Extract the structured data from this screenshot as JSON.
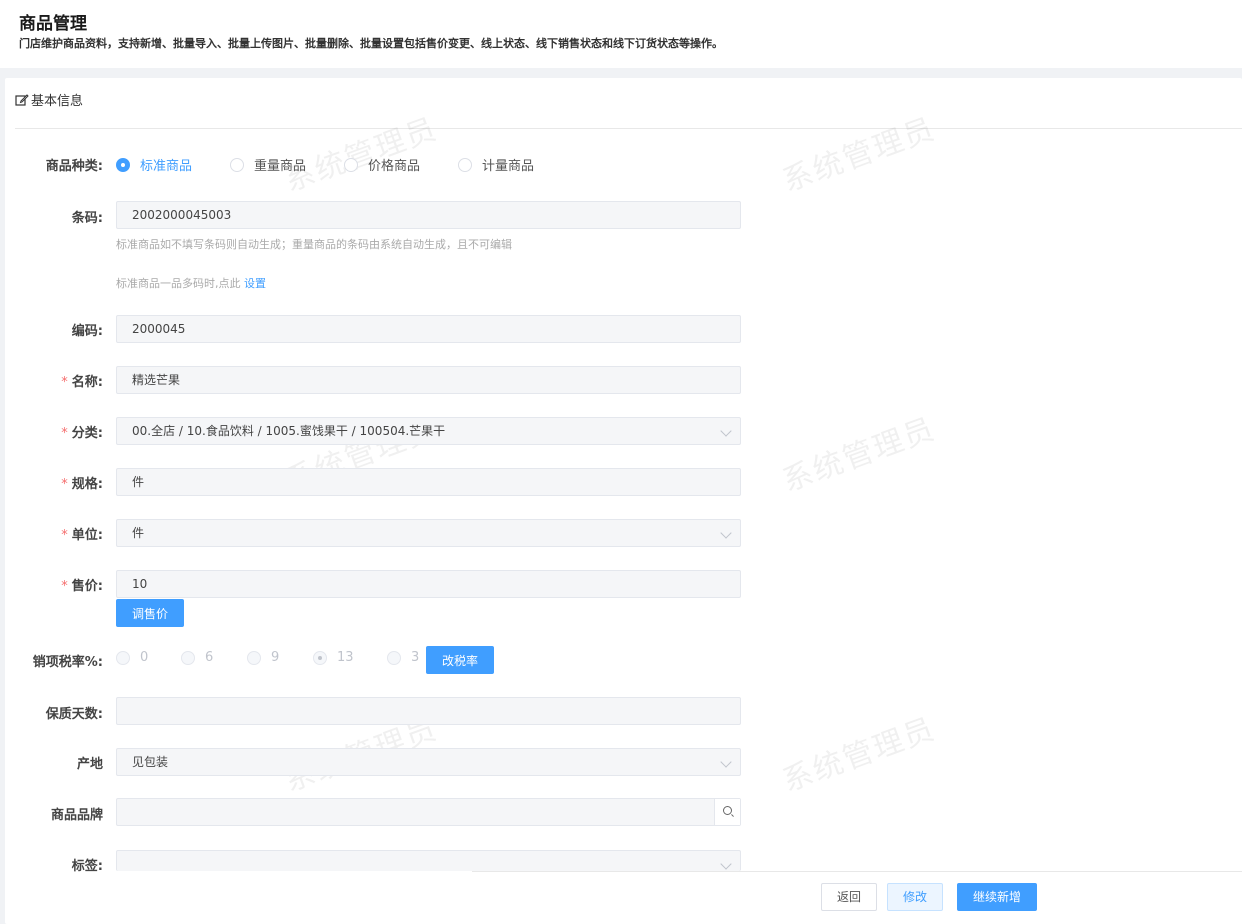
{
  "header": {
    "title": "商品管理",
    "description": "门店维护商品资料，支持新增、批量导入、批量上传图片、批量删除、批量设置包括售价变更、线上状态、线下销售状态和线下订货状态等操作。"
  },
  "section": {
    "title": "基本信息"
  },
  "watermark": "系统管理员",
  "form": {
    "type_label": "商品种类:",
    "types": [
      "标准商品",
      "重量商品",
      "价格商品",
      "计量商品"
    ],
    "type_selected": "标准商品",
    "barcode_label": "条码:",
    "barcode_value": "2002000045003",
    "barcode_hint": "标准商品如不填写条码则自动生成；重量商品的条码由系统自动生成，且不可编辑",
    "multi_hint": "标准商品一品多码时,点此",
    "multi_link": "设置",
    "code_label": "编码:",
    "code_value": "2000045",
    "name_label": "名称:",
    "name_value": "精选芒果",
    "category_label": "分类:",
    "category_value": "00.全店 / 10.食品饮料 / 1005.蜜饯果干 / 100504.芒果干",
    "spec_label": "规格:",
    "spec_value": "件",
    "unit_label": "单位:",
    "unit_value": "件",
    "price_label": "售价:",
    "price_value": "10",
    "adjust_price_button": "调售价",
    "tax_label": "销项税率%:",
    "tax_rates": [
      "0",
      "6",
      "9",
      "13",
      "3"
    ],
    "tax_selected": "13",
    "change_tax_button": "改税率",
    "shelf_label": "保质天数:",
    "shelf_value": "",
    "origin_label": "产地",
    "origin_value": "见包装",
    "brand_label": "商品品牌",
    "brand_value": "",
    "tag_label": "标签:",
    "tag_value": "",
    "required_mark": "*"
  },
  "footer": {
    "return_button": "返回",
    "modify_button": "修改",
    "continue_button": "继续新增"
  },
  "colors": {
    "primary": "#409eff",
    "required": "#f56c6c"
  }
}
